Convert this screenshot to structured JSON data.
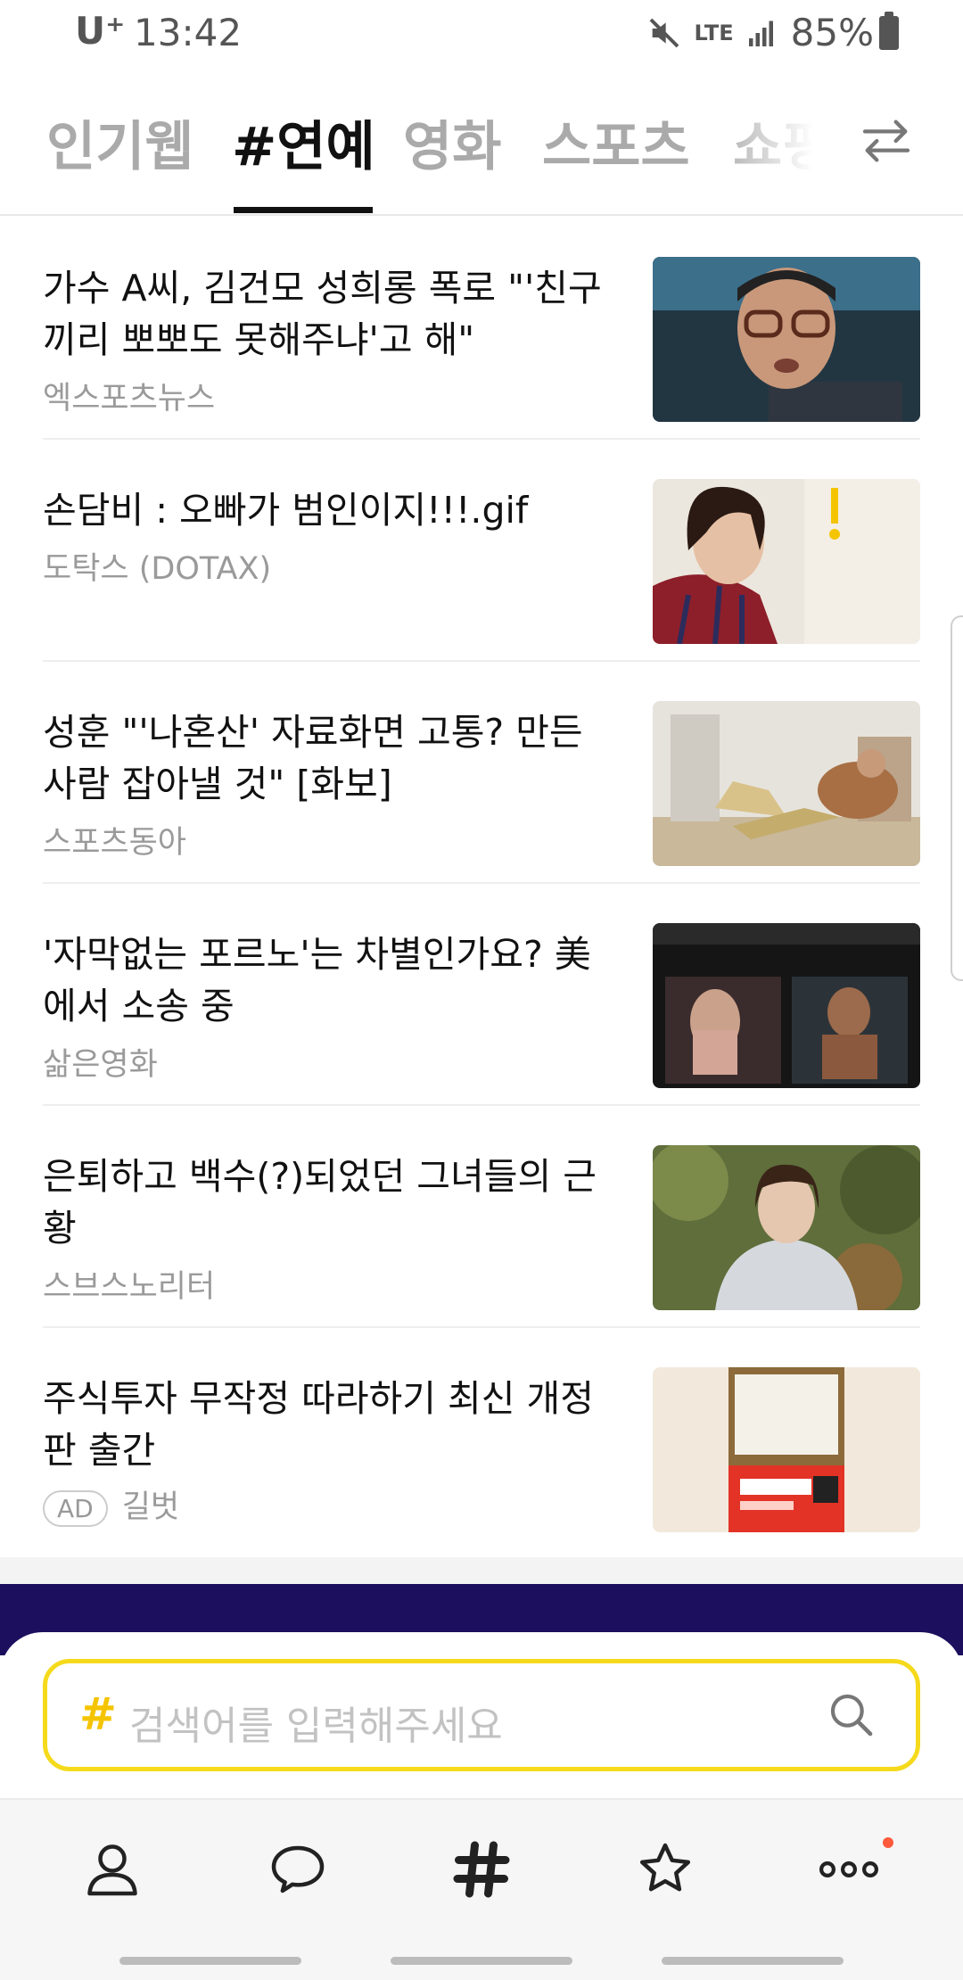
{
  "status_bar": {
    "carrier": "U⁺",
    "time": "13:42",
    "network": "LTE",
    "battery": "85%"
  },
  "tabs": [
    {
      "label": "인기웹",
      "active": false
    },
    {
      "label": "#연예",
      "active": true
    },
    {
      "label": "영화",
      "active": false
    },
    {
      "label": "스포츠",
      "active": false
    },
    {
      "label": "쇼핑",
      "active": false
    }
  ],
  "feed": [
    {
      "title": "가수 A씨, 김건모 성희롱 폭로 \"'친구끼리 뽀뽀도 못해주냐'고 해\"",
      "source": "엑스포츠뉴스",
      "ad": false
    },
    {
      "title": "손담비 : 오빠가 범인이지!!!.gif",
      "source": "도탁스 (DOTAX)",
      "ad": false
    },
    {
      "title": "성훈 \"'나혼산' 자료화면 고통? 만든 사람 잡아낼 것\" [화보]",
      "source": "스포츠동아",
      "ad": false
    },
    {
      "title": "'자막없는 포르노'는 차별인가요? 美에서 소송 중",
      "source": "삶은영화",
      "ad": false
    },
    {
      "title": "은퇴하고 백수(?)되었던 그녀들의 근황",
      "source": "스브스노리터",
      "ad": false
    },
    {
      "title": "주식투자 무작정 따라하기 최신 개정판 출간",
      "source": "길벗",
      "ad": true,
      "ad_label": "AD"
    }
  ],
  "search": {
    "hash": "#",
    "placeholder": "검색어를 입력해주세요"
  },
  "bottom_nav": [
    {
      "icon": "person-icon"
    },
    {
      "icon": "chat-icon"
    },
    {
      "icon": "hashtag-icon",
      "active": true
    },
    {
      "icon": "star-icon"
    },
    {
      "icon": "more-icon",
      "badge": true
    }
  ],
  "colors": {
    "accent": "#f5da1c",
    "badge": "#ff5a3c",
    "banner": "#1c0f5e"
  }
}
